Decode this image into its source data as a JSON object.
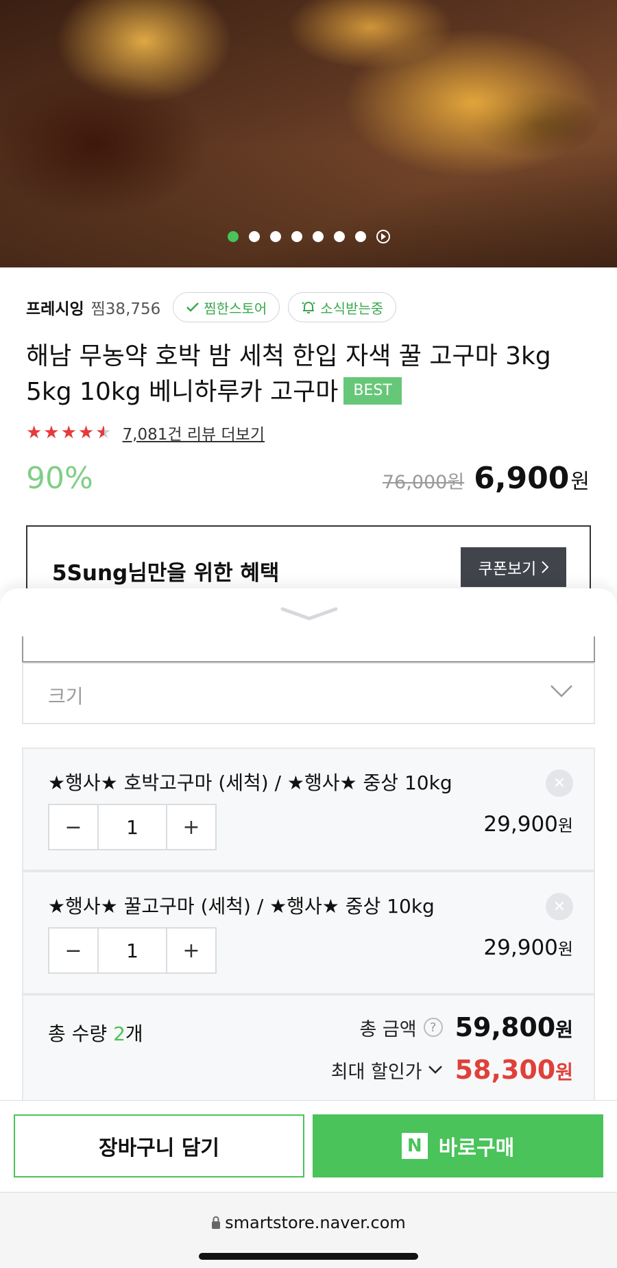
{
  "hero": {
    "slide_count": 7,
    "active_slide": 1
  },
  "store": {
    "name": "프레시잉",
    "zzim": "찜38,756",
    "zzim_store_label": "찜한스토어",
    "news_label": "소식받는중"
  },
  "product": {
    "title": "해남 무농약 호박 밤 세척 한입 자색 꿀 고구마 3kg 5kg 10kg 베니하루카 고구마",
    "badge": "BEST",
    "rating_stars": 4.5,
    "review_link": "7,081건 리뷰 더보기",
    "discount": "90%",
    "original_price": "76,000원",
    "sale_price": "6,900",
    "currency": "원"
  },
  "benefit": {
    "text": "5Sung님만을 위한 혜택",
    "coupon_button": "쿠폰보기"
  },
  "sheet": {
    "size_select_label": "크기",
    "options": [
      {
        "name": "★행사★ 호박고구마 (세척) / ★행사★ 중상 10kg",
        "qty": "1",
        "price": "29,900",
        "currency": "원"
      },
      {
        "name": "★행사★ 꿀고구마 (세척) / ★행사★ 중상 10kg",
        "qty": "1",
        "price": "29,900",
        "currency": "원"
      }
    ],
    "total": {
      "qty_label": "총 수량 ",
      "qty_value": "2",
      "qty_unit": "개",
      "amount_label": "총 금액",
      "amount": "59,800",
      "max_discount_label": "최대 할인가",
      "max_discount_price": "58,300",
      "currency": "원"
    }
  },
  "actions": {
    "cart_label": "장바구니 담기",
    "buy_label": "바로구매",
    "naver_logo": "N"
  },
  "browser": {
    "url": "smartstore.naver.com"
  },
  "colors": {
    "green": "#49c35a",
    "red_price": "#e0403a",
    "dark_button": "#41454b"
  }
}
